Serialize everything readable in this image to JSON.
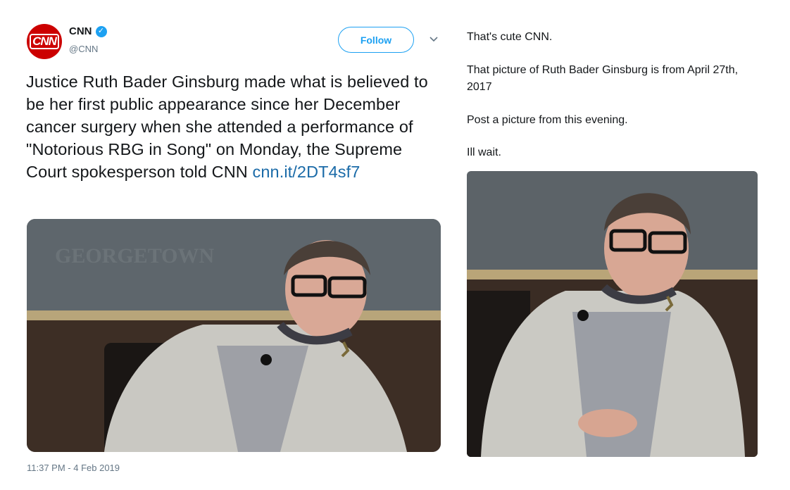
{
  "tweet": {
    "display_name": "CNN",
    "handle": "@CNN",
    "avatar_text": "CNN",
    "verified_mark": "✓",
    "follow_label": "Follow",
    "text_main": "Justice Ruth Bader Ginsburg made what is believed to be her first public appearance since her December cancer surgery when she attended a performance of \"Notorious RBG in Song\" on Monday, the Supreme Court spokesperson told CNN ",
    "link_text": "cnn.it/2DT4sf7",
    "timestamp": "11:37 PM - 4 Feb 2019",
    "photo_backdrop_text": "GEORGETOWN"
  },
  "reply": {
    "line1": "That's cute CNN.",
    "line2": "That picture of Ruth Bader Ginsburg is from April 27th, 2017",
    "line3": "Post a picture from this evening.",
    "line4": "Ill wait."
  },
  "colors": {
    "brand_red": "#cc0000",
    "twitter_blue": "#1da1f2",
    "link_blue": "#1b6ba8",
    "meta_gray": "#657786"
  },
  "icons": {
    "verified": "verified-badge-icon",
    "caret": "chevron-down-icon"
  }
}
